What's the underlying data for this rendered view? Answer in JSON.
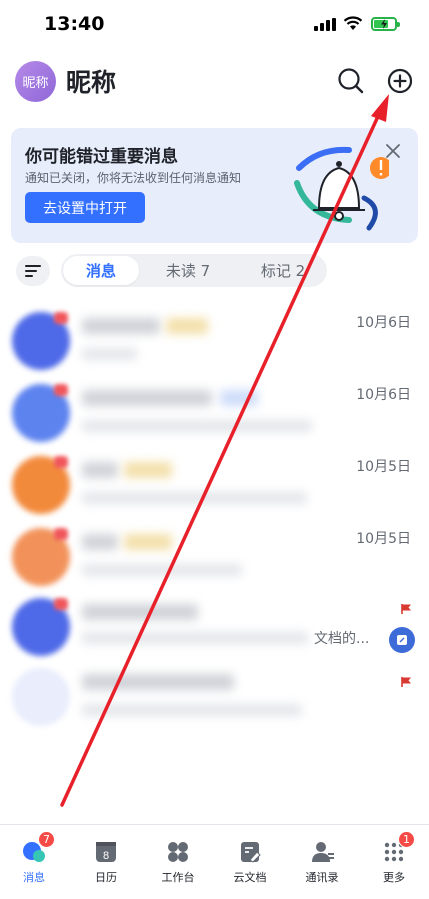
{
  "status_bar": {
    "time": "13:40"
  },
  "header": {
    "avatar_text": "昵称",
    "title": "昵称"
  },
  "banner": {
    "title": "你可能错过重要消息",
    "subtitle": "通知已关闭，你将无法收到任何消息通知",
    "button_label": "去设置中打开"
  },
  "tabs": [
    {
      "label": "消息"
    },
    {
      "label": "未读 7"
    },
    {
      "label": "标记 2"
    }
  ],
  "chats": [
    {
      "time": "10月6日",
      "preview": ""
    },
    {
      "time": "10月6日",
      "preview": ""
    },
    {
      "time": "10月5日",
      "preview": ""
    },
    {
      "time": "10月5日",
      "preview": ""
    },
    {
      "time": "",
      "preview": "文档的..."
    },
    {
      "time": "",
      "preview": ""
    }
  ],
  "bottom_nav": [
    {
      "label": "消息",
      "badge": "7",
      "icon": "chat-bubble-icon"
    },
    {
      "label": "日历",
      "badge": "",
      "icon": "calendar-icon",
      "icon_text": "8"
    },
    {
      "label": "工作台",
      "badge": "",
      "icon": "grid-icon"
    },
    {
      "label": "云文档",
      "badge": "",
      "icon": "document-icon"
    },
    {
      "label": "通讯录",
      "badge": "",
      "icon": "contacts-icon"
    },
    {
      "label": "更多",
      "badge": "1",
      "icon": "more-dots-icon"
    }
  ],
  "colors": {
    "accent": "#3370ff",
    "badge": "#f54a45",
    "arrow": "#e8202a"
  }
}
